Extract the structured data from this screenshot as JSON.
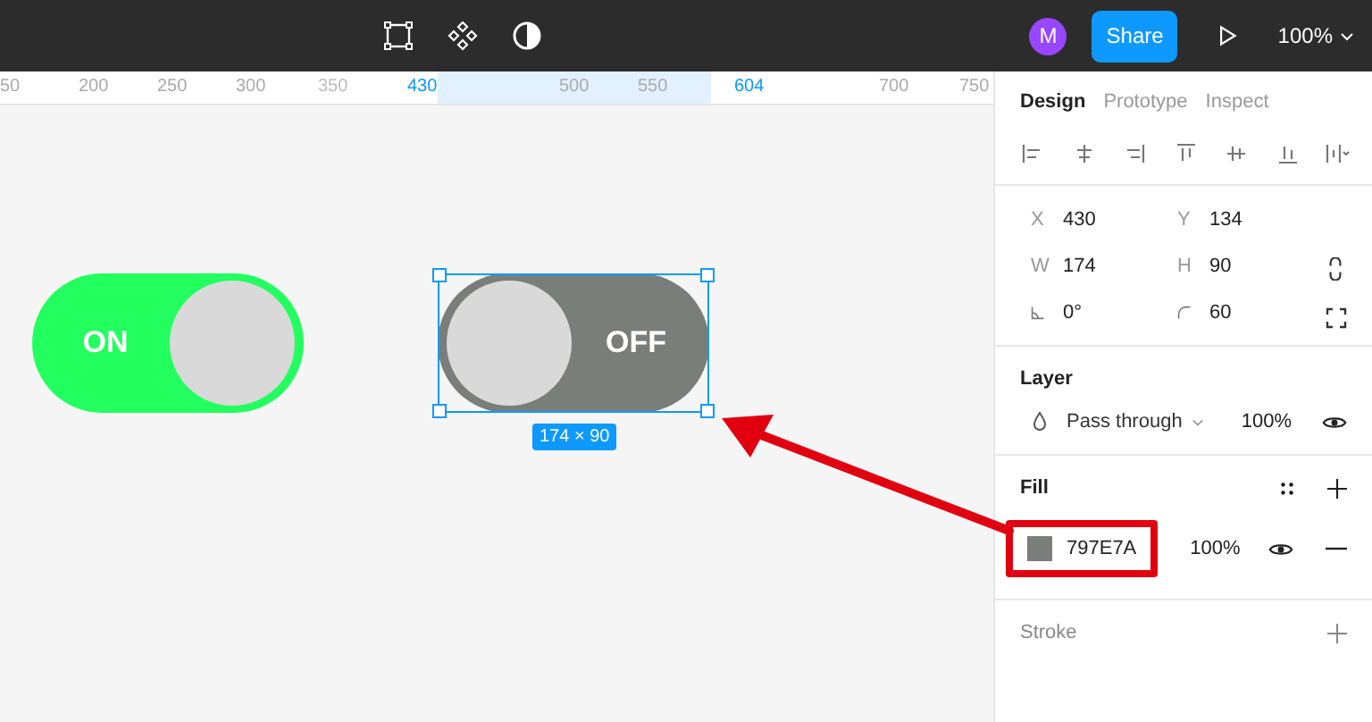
{
  "toolbar": {
    "avatar": "M",
    "share": "Share",
    "zoom": "100%"
  },
  "ruler": [
    {
      "label": "50",
      "kind": "normal"
    },
    {
      "label": "200",
      "kind": "normal"
    },
    {
      "label": "250",
      "kind": "normal"
    },
    {
      "label": "300",
      "kind": "normal"
    },
    {
      "label": "350",
      "kind": "faded"
    },
    {
      "label": "430",
      "kind": "edge"
    },
    {
      "label": "500",
      "kind": "normal"
    },
    {
      "label": "550",
      "kind": "normal"
    },
    {
      "label": "604",
      "kind": "edge"
    },
    {
      "label": "700",
      "kind": "normal"
    },
    {
      "label": "750",
      "kind": "normal"
    }
  ],
  "toggles": [
    {
      "label": "ON",
      "on": true,
      "color": "#22ff5f",
      "selected": false
    },
    {
      "label": "OFF",
      "on": false,
      "color": "#797e7a",
      "selected": true
    }
  ],
  "selection_size": "174 × 90",
  "panel": {
    "tabs": [
      {
        "label": "Design",
        "selected": true
      },
      {
        "label": "Prototype",
        "selected": false
      },
      {
        "label": "Inspect",
        "selected": false
      }
    ],
    "fields": [
      {
        "label": "X",
        "value": "430"
      },
      {
        "label": "Y",
        "value": "134"
      },
      {
        "label": "W",
        "value": "174"
      },
      {
        "label": "H",
        "value": "90"
      },
      {
        "value": "0°"
      },
      {
        "value": "60"
      }
    ],
    "layer": {
      "title": "Layer",
      "blend": "Pass through",
      "opacity": "100%",
      "visible": true
    },
    "fill": {
      "title": "Fill",
      "hex": "797E7A",
      "color": "#797e7a",
      "opacity": "100%",
      "visible": true,
      "highlighted": true
    },
    "stroke": {
      "title": "Stroke"
    }
  }
}
